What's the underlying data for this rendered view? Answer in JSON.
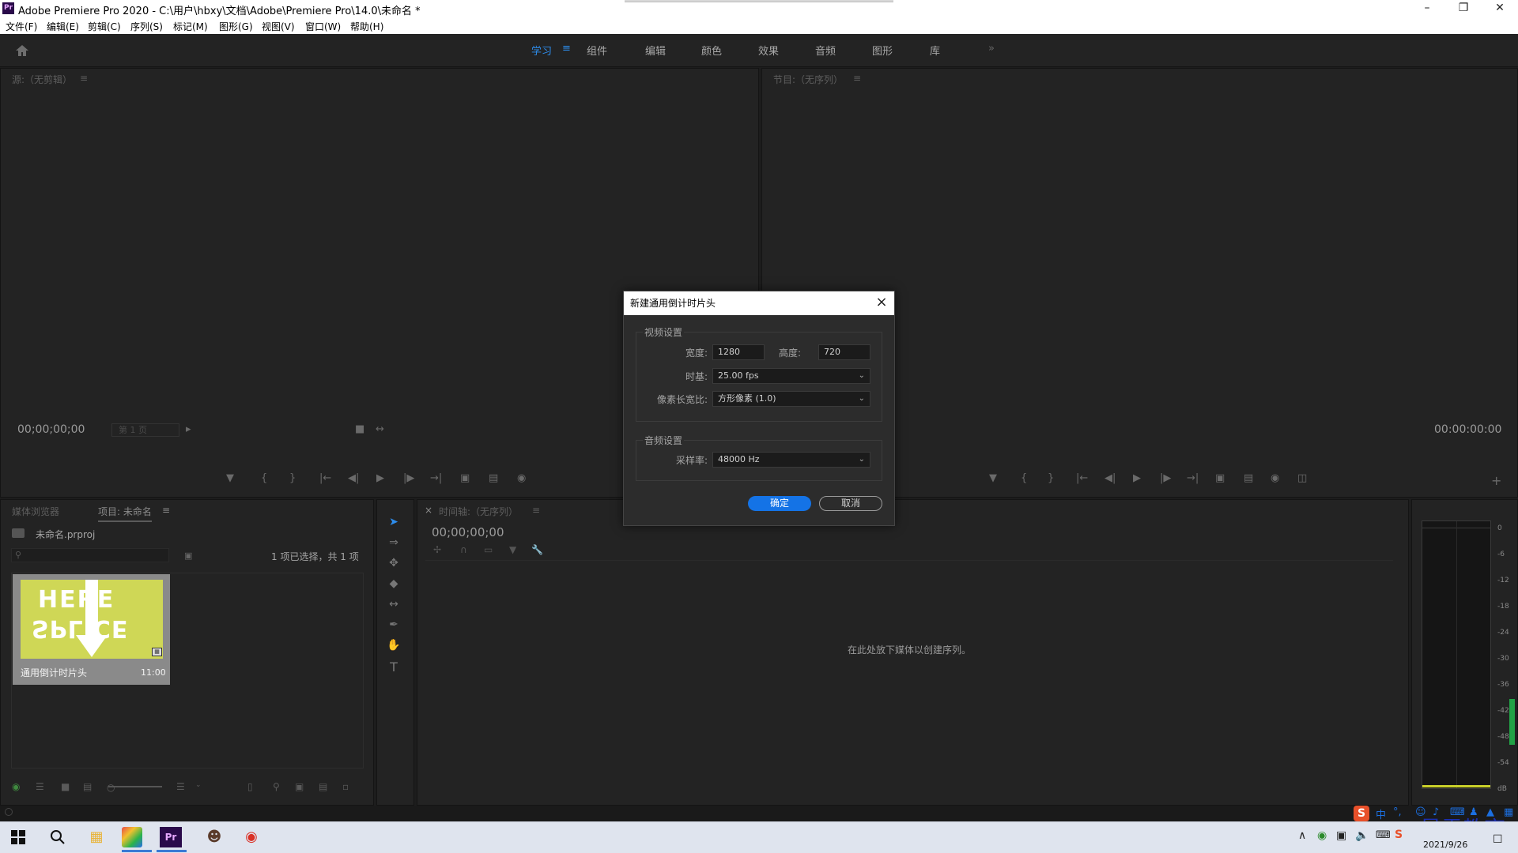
{
  "titlebar": {
    "title": "Adobe Premiere Pro 2020 - C:\\用户\\hbxy\\文档\\Adobe\\Premiere Pro\\14.0\\未命名 *",
    "app_icon": "Pr"
  },
  "menu": [
    "文件(F)",
    "编辑(E)",
    "剪辑(C)",
    "序列(S)",
    "标记(M)",
    "图形(G)",
    "视图(V)",
    "窗口(W)",
    "帮助(H)"
  ],
  "workspaces": {
    "items": [
      "学习",
      "组件",
      "编辑",
      "颜色",
      "效果",
      "音频",
      "图形",
      "库"
    ],
    "active": "学习",
    "more": "»"
  },
  "source_monitor": {
    "title": "源:（无剪辑）",
    "timecode": "00;00;00;00",
    "page": "第 1 页"
  },
  "program_monitor": {
    "title": "节目:（无序列）",
    "timecode": "00:00:00:00"
  },
  "project_panel": {
    "tab_media": "媒体浏览器",
    "tab_project": "项目: 未命名",
    "file": "未命名.prproj",
    "selection": "1 项已选择，共 1 项",
    "item": {
      "name": "通用倒计时片头",
      "duration": "11:00",
      "thumb_top": "HERE",
      "thumb_bottom": "SPLICE"
    }
  },
  "timeline": {
    "title": "时间轴:（无序列）",
    "timecode": "00;00;00;00",
    "drop_hint": "在此处放下媒体以创建序列。"
  },
  "dialog": {
    "title": "新建通用倒计时片头",
    "video_group": "视频设置",
    "width_label": "宽度:",
    "width_value": "1280",
    "height_label": "高度:",
    "height_value": "720",
    "timebase_label": "时基:",
    "timebase_value": "25.00 fps",
    "par_label": "像素长宽比:",
    "par_value": "方形像素 (1.0)",
    "audio_group": "音频设置",
    "samplerate_label": "采样率:",
    "samplerate_value": "48000 Hz",
    "ok": "确定",
    "cancel": "取消"
  },
  "audio_meter": {
    "ticks": [
      "0",
      "-6",
      "-12",
      "-18",
      "-24",
      "-30",
      "-36",
      "-42",
      "-48",
      "-54",
      "dB"
    ]
  },
  "ime": {
    "label": "中"
  },
  "watermark": "最需教育",
  "taskbar": {
    "date": "2021/9/26"
  }
}
